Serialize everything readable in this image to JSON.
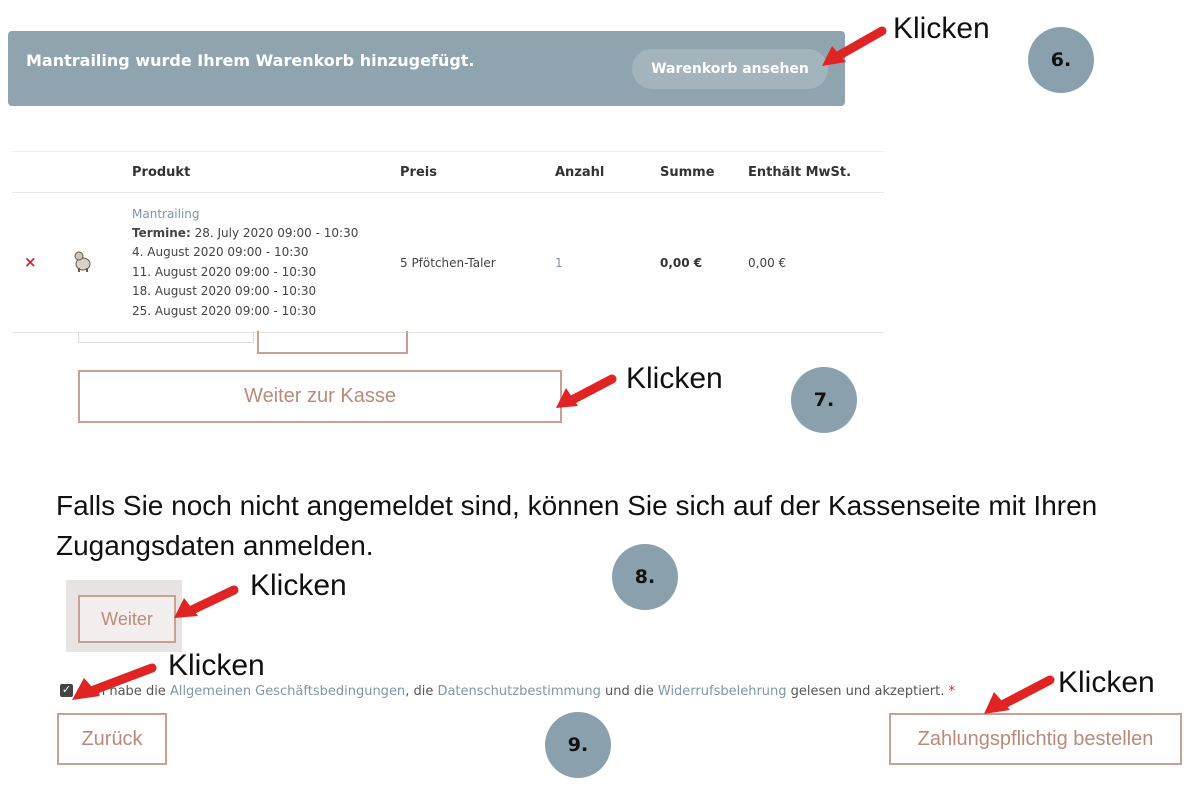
{
  "notice": {
    "message": "Mantrailing wurde Ihrem Warenkorb hinzugefügt.",
    "view_cart_label": "Warenkorb ansehen"
  },
  "steps": [
    "6.",
    "7.",
    "8.",
    "9."
  ],
  "callouts": {
    "view_cart": "Klicken",
    "checkout": "Klicken",
    "weiter": "Klicken",
    "terms": "Klicken",
    "order": "Klicken"
  },
  "cart": {
    "columns": [
      "Produkt",
      "Preis",
      "Anzahl",
      "Summe",
      "Enthält MwSt."
    ],
    "row": {
      "remove_symbol": "×",
      "product_name": "Mantrailing",
      "termine_label": "Termine:",
      "dates": [
        "28. July 2020 09:00 - 10:30",
        "4. August 2020 09:00 - 10:30",
        "11. August 2020 09:00 - 10:30",
        "18. August 2020 09:00 - 10:30",
        "25. August 2020 09:00 - 10:30"
      ],
      "price": "5 Pfötchen-Taler",
      "quantity": "1",
      "sum": "0,00 €",
      "tax": "0,00 €"
    }
  },
  "buttons": {
    "checkout": "Weiter zur Kasse",
    "weiter": "Weiter",
    "back": "Zurück",
    "order": "Zahlungspflichtig bestellen"
  },
  "info_text": "Falls Sie noch nicht angemeldet sind, können Sie sich auf der Kassenseite mit Ihren Zugangsdaten anmelden.",
  "terms": {
    "checked": true,
    "prefix": "Ich habe die ",
    "agb_link": "Allgemeinen Geschäftsbedingungen",
    "sep1": ", die ",
    "privacy_link": "Datenschutzbestimmung",
    "sep2": " und die ",
    "withdrawal_link": "Widerrufsbelehrung",
    "suffix": " gelesen und akzeptiert.",
    "required_mark": "*"
  },
  "colors": {
    "banner": "#8fa4af",
    "step_circle": "#8aa1ad",
    "button_border": "#c8a193",
    "button_text": "#bb8a7b",
    "arrow": "#e02424",
    "link": "#7d97a8"
  }
}
